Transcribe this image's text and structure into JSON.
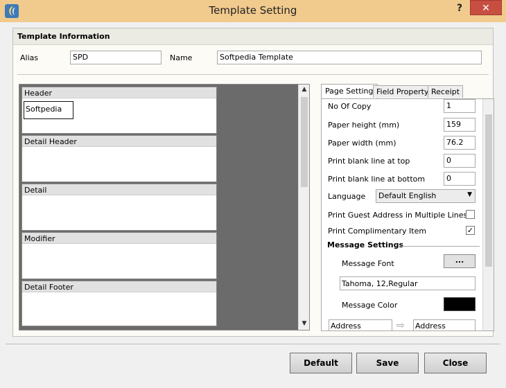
{
  "window": {
    "title": "Template Setting",
    "help_label": "?",
    "close_label": "✕"
  },
  "template_info": {
    "heading": "Template Information",
    "alias_label": "Alias",
    "alias_value": "SPD",
    "name_label": "Name",
    "name_value": "Softpedia Template"
  },
  "designer": {
    "bands": [
      {
        "label": "Header",
        "field": "Softpedia"
      },
      {
        "label": "Detail Header"
      },
      {
        "label": "Detail"
      },
      {
        "label": "Modifier"
      },
      {
        "label": "Detail Footer"
      }
    ]
  },
  "tabs": [
    {
      "label": "Page Setting",
      "active": true
    },
    {
      "label": "Field Property",
      "active": false
    },
    {
      "label": "Receipt",
      "active": false
    }
  ],
  "page_setting": {
    "no_of_copy_label": "No Of Copy",
    "no_of_copy": "1",
    "paper_height_label": "Paper height (mm)",
    "paper_height": "159",
    "paper_width_label": "Paper width (mm)",
    "paper_width": "76.2",
    "blank_top_label": "Print blank line at top",
    "blank_top": "0",
    "blank_bottom_label": "Print blank line at bottom",
    "blank_bottom": "0",
    "language_label": "Language",
    "language": "Default English",
    "guest_address_label": "Print Guest Address in Multiple Lines",
    "guest_address_checked": false,
    "complimentary_label": "Print Complimentary Item",
    "complimentary_checked": true,
    "complimentary_mark": "✓",
    "message_settings_label": "Message Settings",
    "message_font_label": "Message Font",
    "font_button_label": "...",
    "message_font_value": "Tahoma, 12,Regular",
    "message_color_label": "Message Color",
    "message_color": "#000000",
    "address_left": "Address",
    "address_right": "Address"
  },
  "buttons": {
    "default": "Default",
    "save": "Save",
    "close": "Close"
  },
  "colors": {
    "titlebar": "#f1ca8d",
    "close_button": "#c74f41",
    "designer_bg": "#6b6b6b"
  },
  "icons": {
    "app": "app-logo-icon",
    "arrow": "arrow-right-icon",
    "caret": "chevron-down-icon"
  }
}
